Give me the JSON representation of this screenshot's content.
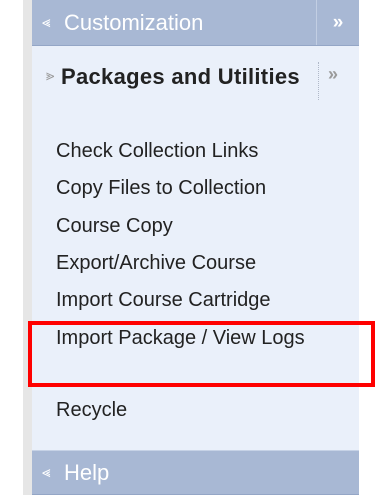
{
  "menu": {
    "customization": {
      "label": "Customization",
      "collapse_glyph": "»",
      "chevron_icon": "chevron-down-double-icon"
    },
    "packages": {
      "title": "Packages and Utilities",
      "collapse_glyph": "»",
      "chevron_icon": "chevron-up-double-icon",
      "items": [
        {
          "label": "Check Collection Links"
        },
        {
          "label": "Copy Files to Collection"
        },
        {
          "label": "Course Copy"
        },
        {
          "label": "Export/Archive Course"
        },
        {
          "label": "Import Course Cartridge"
        },
        {
          "label": "Import Package / View Logs",
          "highlighted": true
        },
        {
          "label": "Recycle"
        }
      ]
    },
    "help": {
      "label": "Help",
      "chevron_icon": "chevron-down-double-icon"
    }
  },
  "colors": {
    "header_bar": "#a8b8d4",
    "section_bg": "#eaf0fa",
    "highlight_border": "#ff0000"
  }
}
